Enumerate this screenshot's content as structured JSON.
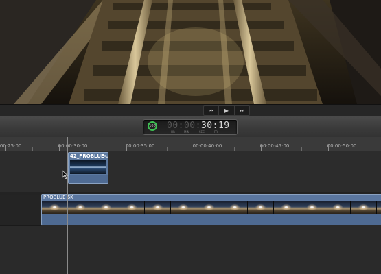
{
  "transport": {
    "prev_glyph": "⏮",
    "play_glyph": "▶",
    "next_glyph": "⏭"
  },
  "timecode": {
    "badge": "100",
    "dim_digits": "00:00:",
    "lit_digits": "30:19",
    "labels": [
      "HR",
      "MIN",
      "SEC",
      "FR"
    ]
  },
  "ruler": {
    "ticks": [
      "00:00:25:00",
      "00:00:30:00",
      "00:00:35:00",
      "00:00:40:00",
      "00:00:45:00",
      "00:00:50:00"
    ]
  },
  "clips": {
    "connected_name": "42_PROBLUE-...",
    "main_name": "PROBLUE 6K"
  },
  "colors": {
    "clip_blue": "#5b77a0",
    "timecode_ring": "#3ec153"
  },
  "icons": {
    "prev": "skip-back-icon",
    "play": "play-icon",
    "next": "skip-forward-icon",
    "cursor": "arrow-cursor-icon"
  }
}
